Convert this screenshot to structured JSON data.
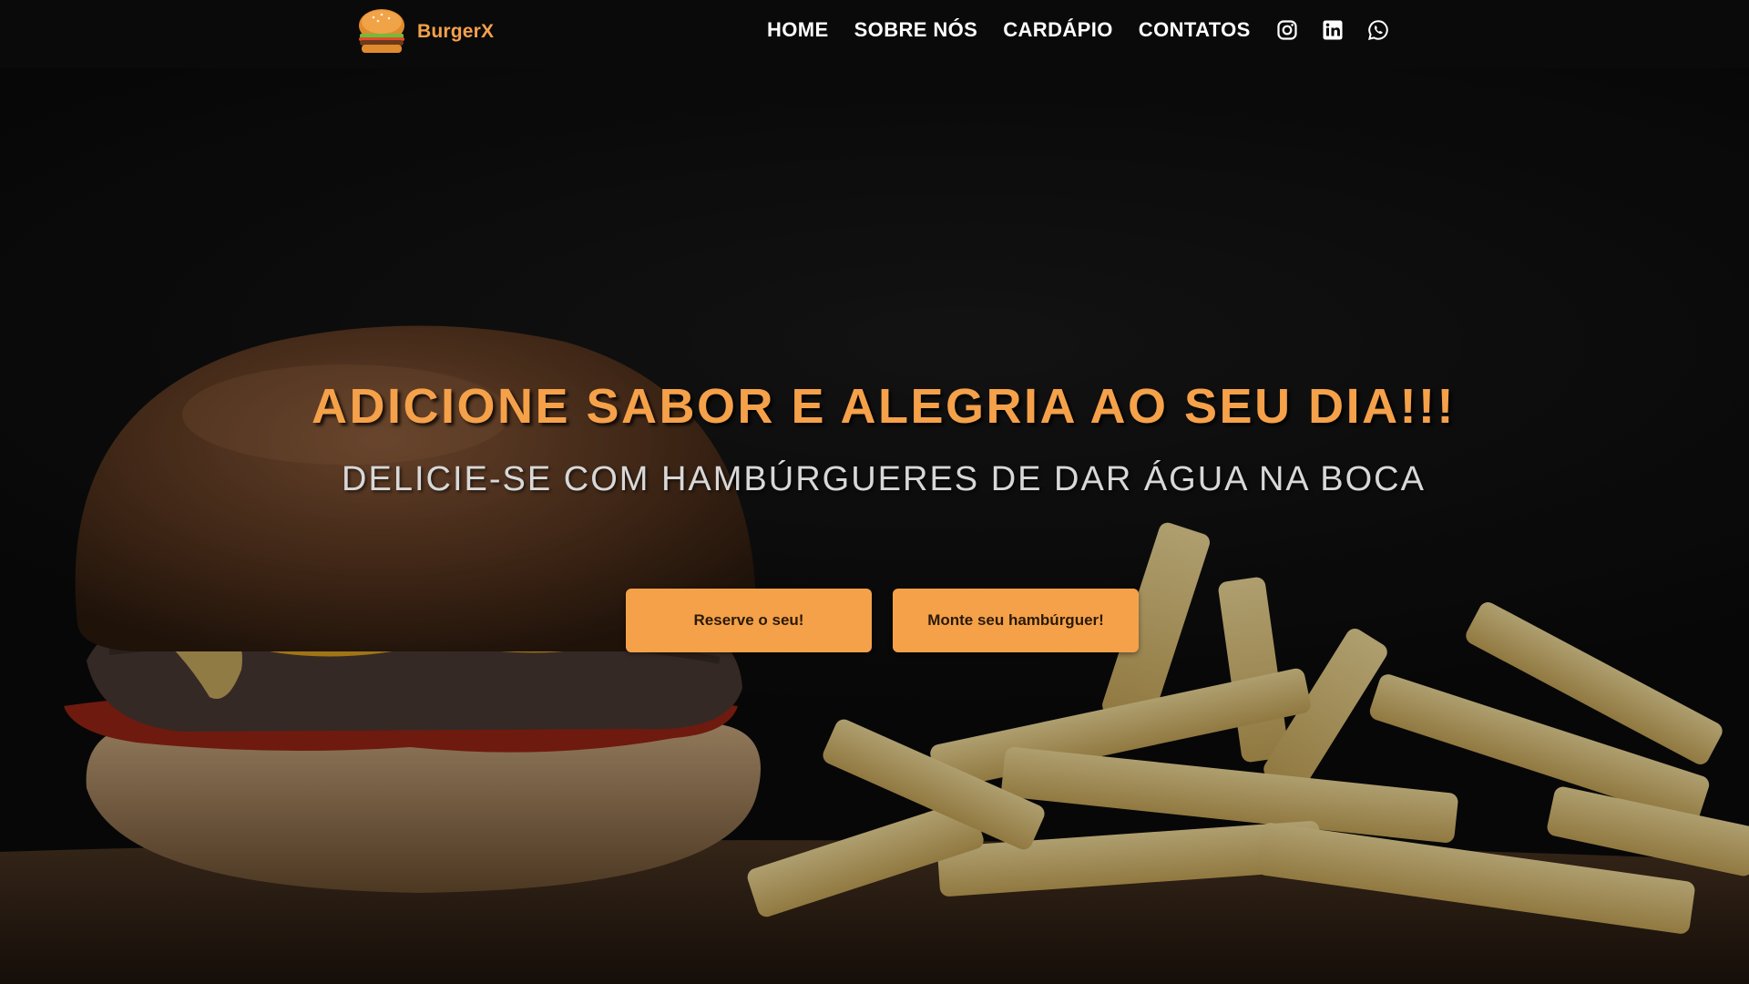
{
  "brand": {
    "name": "BurgerX",
    "logo_icon": "burger-logo-icon",
    "accent_color": "#f5a14a"
  },
  "nav": {
    "items": [
      {
        "label": "HOME"
      },
      {
        "label": "SOBRE NÓS"
      },
      {
        "label": "CARDÁPIO"
      },
      {
        "label": "CONTATOS"
      }
    ],
    "social": [
      {
        "icon": "instagram-icon"
      },
      {
        "icon": "linkedin-icon"
      },
      {
        "icon": "whatsapp-icon"
      }
    ]
  },
  "hero": {
    "title": "ADICIONE SABOR E ALEGRIA AO SEU DIA!!!",
    "subtitle": "DELICIE-SE COM HAMBÚRGUERES DE DAR ÁGUA NA BOCA",
    "buttons": {
      "reserve": "Reserve o seu!",
      "build": "Monte seu hambúrguer!"
    },
    "background_image": "burger-and-fries-photo"
  }
}
